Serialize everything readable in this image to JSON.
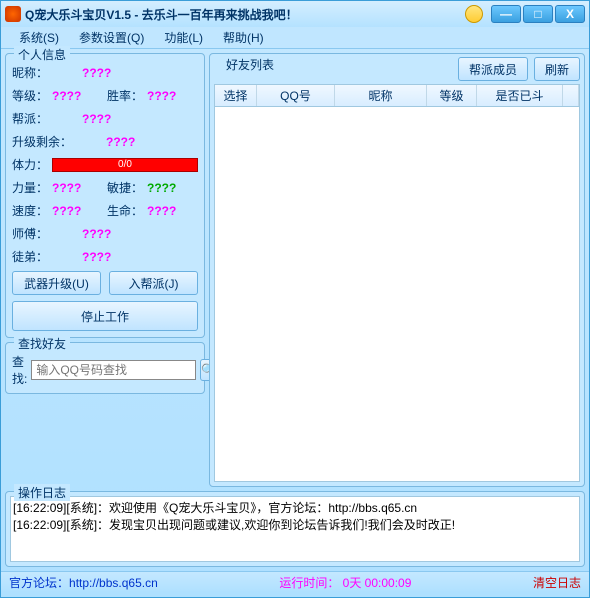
{
  "window": {
    "title": "Q宠大乐斗宝贝V1.5 - 去乐斗一百年再来挑战我吧！"
  },
  "menu": {
    "system": "系统(S)",
    "param": "参数设置(Q)",
    "func": "功能(L)",
    "help": "帮助(H)"
  },
  "info": {
    "legend": "个人信息",
    "nickname_lbl": "昵称：",
    "nickname": "????",
    "level_lbl": "等级：",
    "level": "????",
    "winrate_lbl": "胜率：",
    "winrate": "????",
    "faction_lbl": "帮派：",
    "faction": "????",
    "upgrade_lbl": "升级剩余：",
    "upgrade": "????",
    "hp_lbl": "体力：",
    "hp_text": "0/0",
    "str_lbl": "力量：",
    "str": "????",
    "agi_lbl": "敏捷：",
    "agi": "????",
    "spd_lbl": "速度：",
    "spd": "????",
    "life_lbl": "生命：",
    "life": "????",
    "master_lbl": "师傅：",
    "master": "????",
    "apprentice_lbl": "徒弟：",
    "apprentice": "????"
  },
  "buttons": {
    "weapon": "武器升级(U)",
    "join": "入帮派(J)",
    "stop": "停止工作"
  },
  "search": {
    "legend": "查找好友",
    "label": "查找:",
    "placeholder": "输入QQ号码查找"
  },
  "friends": {
    "legend": "好友列表",
    "members": "帮派成员",
    "refresh": "刷新",
    "cols": {
      "select": "选择",
      "qq": "QQ号",
      "nick": "昵称",
      "level": "等级",
      "fought": "是否已斗"
    }
  },
  "log": {
    "legend": "操作日志",
    "line1": "[16:22:09][系统]：欢迎使用《Q宠大乐斗宝贝》，官方论坛：http://bbs.q65.cn",
    "line2": "[16:22:09][系统]：发现宝贝出现问题或建议,欢迎你到论坛告诉我们!我们会及时改正!"
  },
  "status": {
    "forum_lbl": "官方论坛：",
    "forum_url": "http://bbs.q65.cn",
    "runtime_lbl": "运行时间：",
    "runtime_val": " 0天 00:00:09",
    "clear": "清空日志"
  }
}
